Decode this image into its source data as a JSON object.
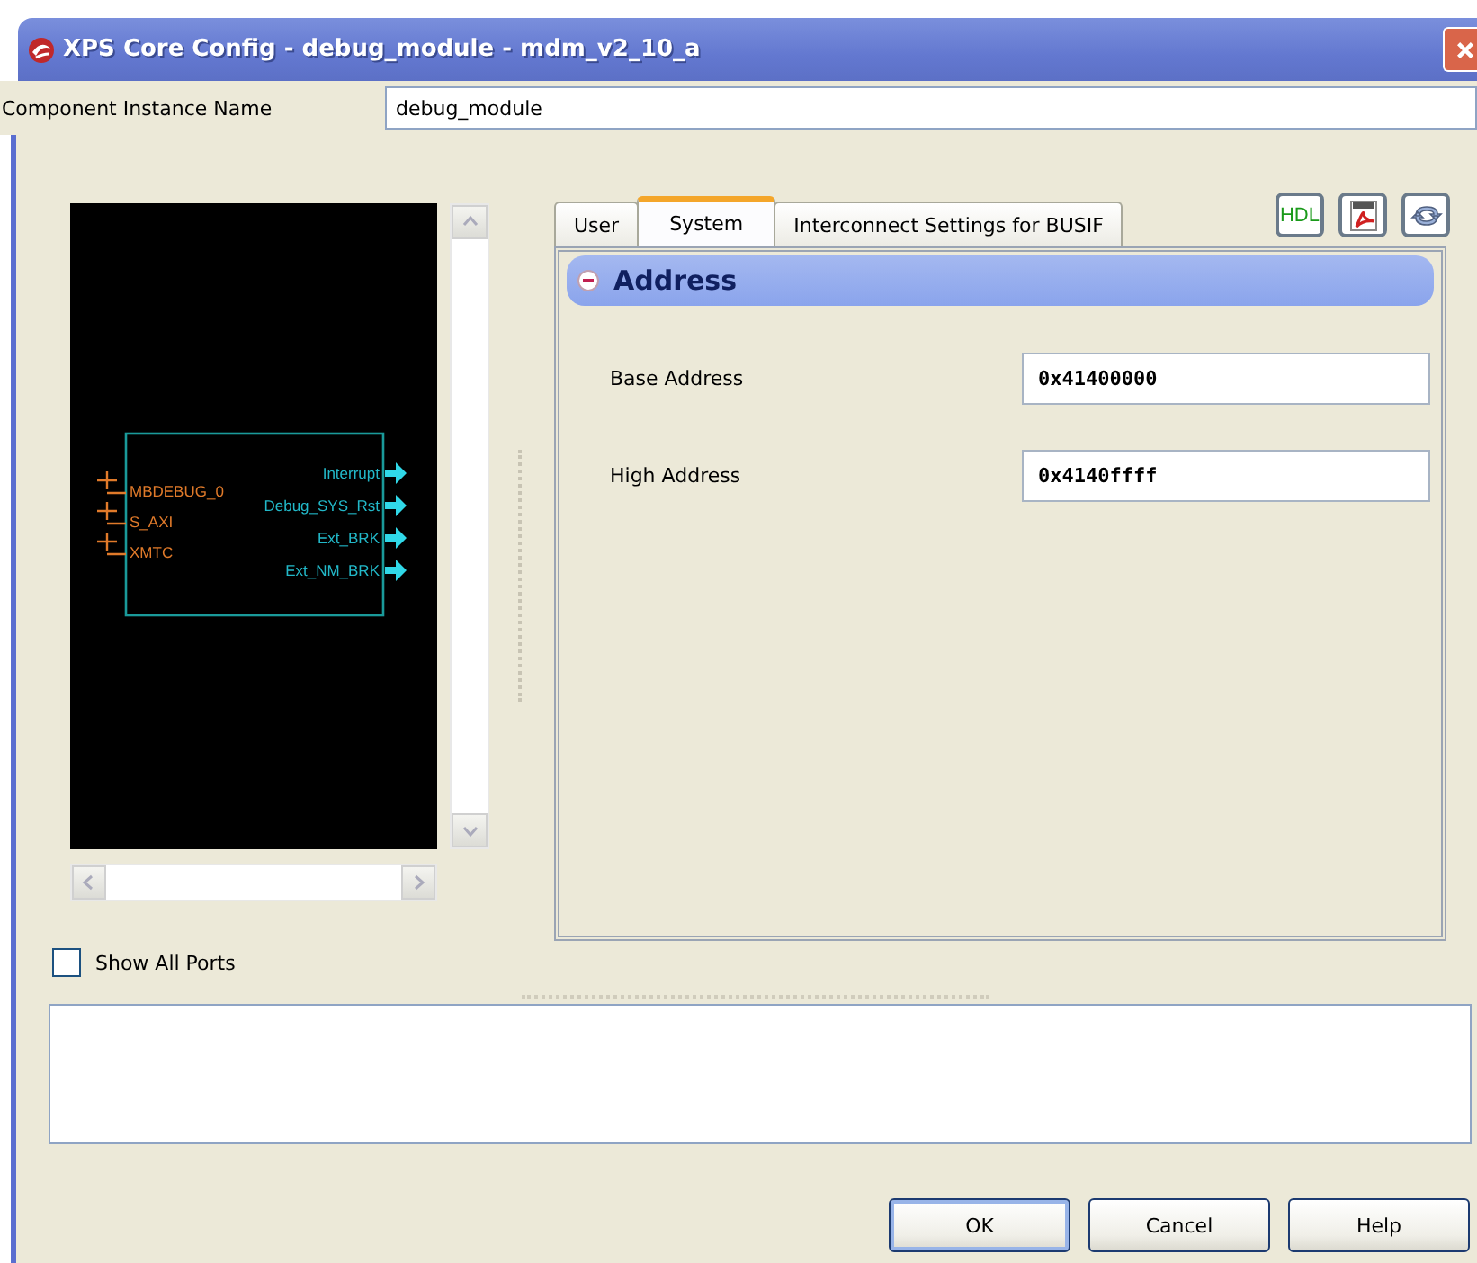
{
  "window": {
    "title": "XPS Core Config - debug_module - mdm_v2_10_a"
  },
  "instance_name": {
    "label": "Component Instance Name",
    "value": "debug_module"
  },
  "schematic": {
    "inputs": [
      "MBDEBUG_0",
      "S_AXI",
      "XMTC"
    ],
    "outputs": [
      "Interrupt",
      "Debug_SYS_Rst",
      "Ext_BRK",
      "Ext_NM_BRK"
    ]
  },
  "show_all_ports": {
    "label": "Show All Ports",
    "checked": false
  },
  "tabs": [
    {
      "label": "User",
      "selected": false
    },
    {
      "label": "System",
      "selected": true
    },
    {
      "label": "Interconnect Settings for BUSIF",
      "selected": false
    }
  ],
  "toolbar": [
    {
      "kind": "hdl",
      "label": "HDL"
    },
    {
      "kind": "pdf"
    },
    {
      "kind": "refresh"
    }
  ],
  "group": {
    "title": "Address",
    "expanded": true,
    "params": [
      {
        "label": "Base Address",
        "value": "0x41400000"
      },
      {
        "label": "High Address",
        "value": "0x4140ffff"
      }
    ]
  },
  "buttons": [
    {
      "label": "OK",
      "default": true
    },
    {
      "label": "Cancel",
      "default": false
    },
    {
      "label": "Help",
      "default": false
    }
  ]
}
